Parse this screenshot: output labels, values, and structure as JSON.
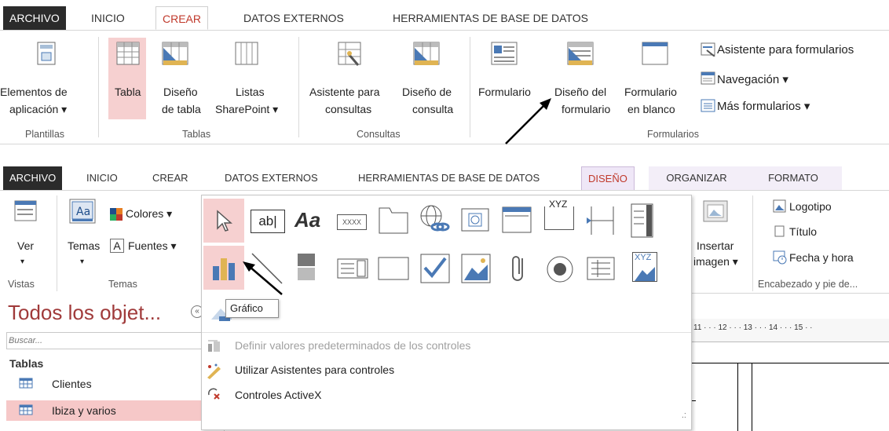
{
  "top_ribbon": {
    "tabs": [
      "ARCHIVO",
      "INICIO",
      "CREAR",
      "DATOS EXTERNOS",
      "HERRAMIENTAS DE BASE DE DATOS"
    ],
    "plantillas": {
      "btn_line1": "Elementos de",
      "btn_line2": "aplicación ▾",
      "group": "Plantillas"
    },
    "tablas": {
      "tabla": "Tabla",
      "diseno_1": "Diseño",
      "diseno_2": "de tabla",
      "listas_1": "Listas",
      "listas_2": "SharePoint ▾",
      "group": "Tablas"
    },
    "consultas": {
      "asistente_1": "Asistente para",
      "asistente_2": "consultas",
      "diseno_1": "Diseño de",
      "diseno_2": "consulta",
      "group": "Consultas"
    },
    "formularios": {
      "formulario": "Formulario",
      "diseno_1": "Diseño del",
      "diseno_2": "formulario",
      "blanco_1": "Formulario",
      "blanco_2": "en blanco",
      "asistente": "Asistente para formularios",
      "navegacion": "Navegación ▾",
      "mas": "Más formularios ▾",
      "group": "Formularios"
    }
  },
  "bottom_ribbon": {
    "tabs": [
      "ARCHIVO",
      "INICIO",
      "CREAR",
      "DATOS EXTERNOS",
      "HERRAMIENTAS DE BASE DE DATOS",
      "DISEÑO",
      "ORGANIZAR",
      "FORMATO"
    ],
    "vistas": {
      "ver": "Ver",
      "arrow": "▾",
      "group": "Vistas"
    },
    "temas": {
      "temas": "Temas",
      "colores": "Colores ▾",
      "fuentes": "Fuentes ▾",
      "group": "Temas",
      "fuentes_glyph": "A"
    },
    "insertar": {
      "line1": "Insertar",
      "line2": "imagen ▾"
    },
    "encabezado": {
      "logotipo": "Logotipo",
      "titulo": "Título",
      "fecha": "Fecha y hora",
      "group": "Encabezado y pie de..."
    }
  },
  "gallery": {
    "tooltip": "Gráfico",
    "textbox_glyph": "ab|",
    "label_glyph": "Aa",
    "xxxx": "XXXX",
    "xyz": "XYZ",
    "menu": [
      {
        "label": "Definir valores predeterminados de los controles",
        "enabled": false
      },
      {
        "label": "Utilizar Asistentes para controles",
        "enabled": true
      },
      {
        "label": "Controles ActiveX",
        "enabled": true
      }
    ]
  },
  "nav_pane": {
    "title": "Todos los objet...",
    "search_placeholder": "Buscar...",
    "section": "Tablas",
    "items": [
      "Clientes",
      "Ibiza y varios"
    ]
  },
  "ruler": {
    "text": "11 · · · 12 · · · 13 · · · 14 · · · 15 · ·"
  }
}
